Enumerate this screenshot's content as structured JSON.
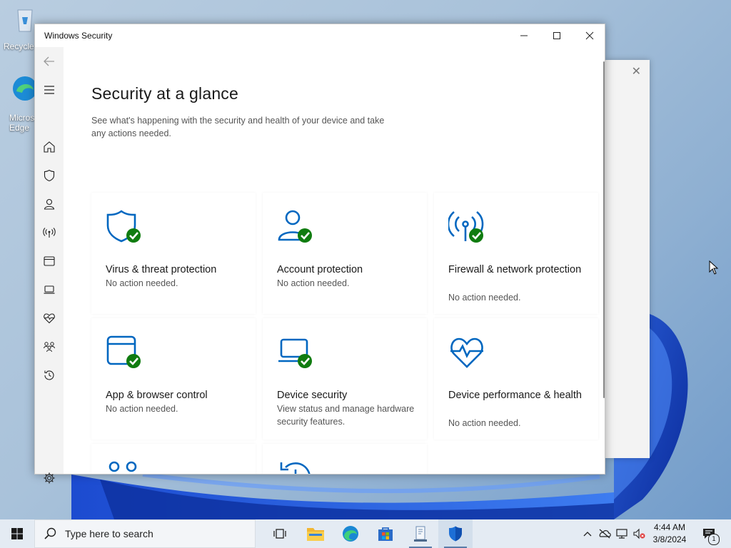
{
  "desktop": {
    "icons": [
      {
        "label": "Recycle Bin"
      },
      {
        "label": "Microsoft Edge"
      }
    ]
  },
  "window": {
    "title": "Windows Security",
    "controls": {
      "minimize": "minimize",
      "maximize": "maximize",
      "close": "close"
    }
  },
  "page": {
    "heading": "Security at a glance",
    "description": "See what's happening with the security and health of your device and take any actions needed."
  },
  "sidebar": {
    "items": [
      {
        "name": "back",
        "icon": "back-arrow-icon"
      },
      {
        "name": "menu",
        "icon": "hamburger-icon"
      },
      {
        "name": "home",
        "icon": "home-icon"
      },
      {
        "name": "virus-threat",
        "icon": "shield-icon"
      },
      {
        "name": "account",
        "icon": "person-icon"
      },
      {
        "name": "firewall",
        "icon": "antenna-icon"
      },
      {
        "name": "app-browser",
        "icon": "browser-window-icon"
      },
      {
        "name": "device-security",
        "icon": "laptop-icon"
      },
      {
        "name": "device-performance",
        "icon": "heart-pulse-icon"
      },
      {
        "name": "family",
        "icon": "family-icon"
      },
      {
        "name": "history",
        "icon": "history-icon"
      },
      {
        "name": "settings",
        "icon": "gear-icon"
      }
    ]
  },
  "cards": [
    {
      "title": "Virus & threat protection",
      "status": "No action needed.",
      "icon": "shield-check-icon"
    },
    {
      "title": "Account protection",
      "status": "No action needed.",
      "icon": "person-check-icon"
    },
    {
      "title": "Firewall & network protection",
      "status": "No action needed.",
      "icon": "antenna-check-icon"
    },
    {
      "title": "App & browser control",
      "status": "No action needed.",
      "icon": "browser-check-icon"
    },
    {
      "title": "Device security",
      "status": "View status and manage hardware security features.",
      "icon": "laptop-check-icon"
    },
    {
      "title": "Device performance & health",
      "status": "No action needed.",
      "icon": "heart-pulse-icon"
    },
    {
      "title": "",
      "status": "",
      "icon": "family-icon"
    },
    {
      "title": "",
      "status": "",
      "icon": "history-icon"
    }
  ],
  "taskbar": {
    "search_placeholder": "Type here to search",
    "time": "4:44 AM",
    "date": "3/8/2024",
    "notification_count": "1"
  },
  "colors": {
    "accent": "#0067c0",
    "check": "#107c10",
    "sidebar_bg": "#f3f3f3"
  }
}
